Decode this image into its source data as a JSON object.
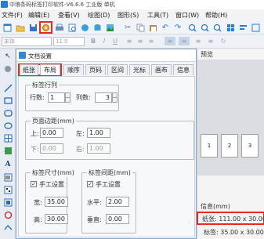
{
  "window": {
    "title": "中琅条码标签打印软件-V6.6.6 工业版 单机"
  },
  "menu": [
    "文件(F)",
    "编辑(E)",
    "查看(V)",
    "绘图(D)",
    "图形(S)",
    "工具(T)",
    "窗口(W)",
    "帮助(H)"
  ],
  "toolbar2": {
    "font_name": "宋体",
    "font_size": "11.0",
    "format": [
      "B",
      "I",
      "U"
    ]
  },
  "dialog": {
    "title": "文档设置",
    "tabs": [
      "纸张",
      "布局",
      "顺序",
      "页码",
      "区间",
      "光标",
      "画布",
      "信息"
    ],
    "label_rows_cols": {
      "legend": "标签行列",
      "rows_label": "行数:",
      "rows_value": "1",
      "cols_label": "列数:",
      "cols_value": "3"
    },
    "page_margins": {
      "legend": "页面边距(mm)",
      "top_label": "上:",
      "top_value": "0.00",
      "left_label": "左:",
      "left_value": "1.00",
      "bottom_label": "下:",
      "bottom_value": "0.00",
      "right_label": "右:",
      "right_value": "1.00"
    },
    "label_size": {
      "legend": "标签尺寸(mm)",
      "manual_label": "手工设置",
      "manual_checked": true,
      "width_label": "宽:",
      "width_value": "35.00",
      "height_label": "高:",
      "height_value": "30.00"
    },
    "label_spacing": {
      "legend": "标签间距(mm)",
      "manual_label": "手工设置",
      "manual_checked": true,
      "h_label": "水平:",
      "h_value": "2.00",
      "v_label": "垂直:",
      "v_value": "0.00"
    }
  },
  "preview": {
    "label": "预览",
    "cards": [
      "1",
      "2",
      "3"
    ],
    "info_label": "信息(mm)",
    "paper_info": "纸张: 111.00 x 30.00",
    "label_info": "标签: 35.00 x 30.00"
  },
  "colors": {
    "highlight": "#e52a1f",
    "accent": "#2a7bd4"
  }
}
